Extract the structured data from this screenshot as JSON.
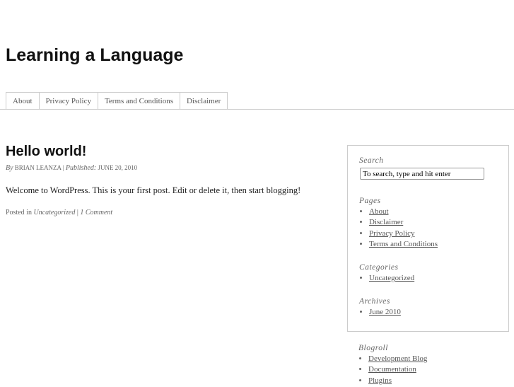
{
  "site": {
    "title": "Learning a Language"
  },
  "nav": [
    "About",
    "Privacy Policy",
    "Terms and Conditions",
    "Disclaimer"
  ],
  "post": {
    "title": "Hello world!",
    "by_label": "By",
    "author": "BRIAN LEANZA",
    "sep": "|",
    "published_label": "Published:",
    "date": "JUNE 20, 2010",
    "content": "Welcome to WordPress. This is your first post. Edit or delete it, then start blogging!",
    "posted_in": "Posted in",
    "category": "Uncategorized",
    "comments": "1 Comment"
  },
  "sidebar": {
    "search_title": "Search",
    "search_value": "To search, type and hit enter",
    "pages_title": "Pages",
    "pages": [
      "About",
      "Disclaimer",
      "Privacy Policy",
      "Terms and Conditions"
    ],
    "categories_title": "Categories",
    "categories": [
      "Uncategorized"
    ],
    "archives_title": "Archives",
    "archives": [
      "June 2010"
    ],
    "blogroll_title": "Blogroll",
    "blogroll": [
      "Development Blog",
      "Documentation",
      "Plugins"
    ]
  }
}
